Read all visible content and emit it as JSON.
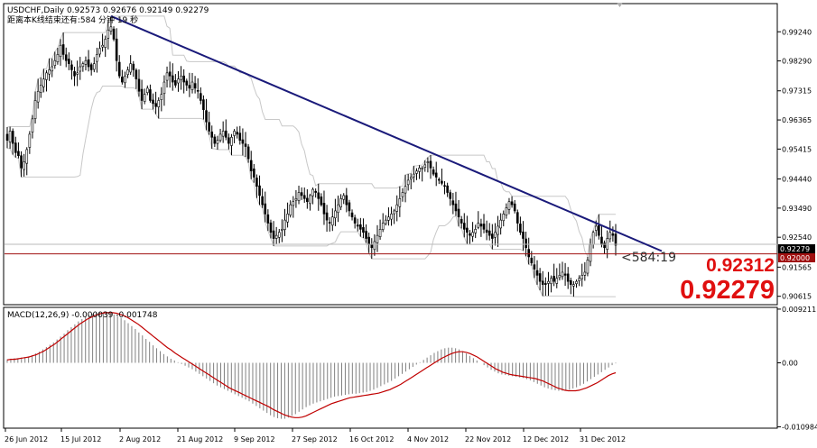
{
  "header": {
    "symbol_line": "USDCHF,Daily  0.92573 0.92676 0.92149 0.92279",
    "countdown_line": "距离本K线结束还有:584 分钟 19 秒"
  },
  "macd_header": "MACD(12,26,9) -0.000039 -0.001748",
  "countdown_label": "<584:19",
  "big_prices": [
    "0.92312",
    "0.92279"
  ],
  "price_tags": {
    "current": "0.92279",
    "line": "0.92000"
  },
  "colors": {
    "trend_line": "#1a1a7a",
    "support_line": "#a01010",
    "signal_line": "#c00000",
    "big_price": "#e01010",
    "band": "#c8c8c8",
    "candle": "#000000"
  },
  "chart_data": [
    {
      "type": "candlestick",
      "title": "USDCHF,Daily",
      "ylim": [
        0.904,
        1.001
      ],
      "y_ticks": [
        "0.99240",
        "0.98290",
        "0.97315",
        "0.96365",
        "0.95415",
        "0.94440",
        "0.93490",
        "0.92540",
        "0.91565",
        "0.90615"
      ],
      "x_ticks": [
        "26 Jun 2012",
        "15 Jul 2012",
        "2 Aug 2012",
        "21 Aug 2012",
        "9 Sep 2012",
        "27 Sep 2012",
        "16 Oct 2012",
        "4 Nov 2012",
        "22 Nov 2012",
        "12 Dec 2012",
        "31 Dec 2012"
      ],
      "closes": [
        0.957,
        0.96,
        0.956,
        0.953,
        0.952,
        0.948,
        0.95,
        0.954,
        0.959,
        0.964,
        0.97,
        0.973,
        0.975,
        0.977,
        0.979,
        0.98,
        0.981,
        0.983,
        0.985,
        0.988,
        0.985,
        0.983,
        0.982,
        0.98,
        0.978,
        0.979,
        0.981,
        0.982,
        0.983,
        0.981,
        0.98,
        0.982,
        0.985,
        0.987,
        0.988,
        0.99,
        0.993,
        0.994,
        0.99,
        0.983,
        0.978,
        0.976,
        0.978,
        0.98,
        0.982,
        0.98,
        0.977,
        0.973,
        0.97,
        0.972,
        0.974,
        0.97,
        0.969,
        0.968,
        0.97,
        0.972,
        0.976,
        0.979,
        0.978,
        0.976,
        0.975,
        0.977,
        0.978,
        0.976,
        0.975,
        0.974,
        0.976,
        0.974,
        0.973,
        0.97,
        0.967,
        0.963,
        0.96,
        0.958,
        0.956,
        0.957,
        0.959,
        0.96,
        0.958,
        0.956,
        0.958,
        0.96,
        0.959,
        0.957,
        0.956,
        0.955,
        0.951,
        0.947,
        0.945,
        0.942,
        0.939,
        0.936,
        0.933,
        0.93,
        0.927,
        0.925,
        0.926,
        0.927,
        0.928,
        0.931,
        0.933,
        0.936,
        0.937,
        0.938,
        0.94,
        0.939,
        0.938,
        0.937,
        0.939,
        0.941,
        0.94,
        0.938,
        0.936,
        0.933,
        0.931,
        0.93,
        0.932,
        0.934,
        0.936,
        0.938,
        0.939,
        0.936,
        0.934,
        0.932,
        0.93,
        0.929,
        0.928,
        0.927,
        0.925,
        0.923,
        0.922,
        0.924,
        0.926,
        0.928,
        0.93,
        0.931,
        0.932,
        0.933,
        0.934,
        0.936,
        0.938,
        0.94,
        0.942,
        0.944,
        0.945,
        0.946,
        0.947,
        0.948,
        0.948,
        0.949,
        0.95,
        0.948,
        0.946,
        0.945,
        0.944,
        0.943,
        0.942,
        0.94,
        0.938,
        0.936,
        0.934,
        0.932,
        0.93,
        0.928,
        0.927,
        0.926,
        0.927,
        0.928,
        0.93,
        0.929,
        0.928,
        0.927,
        0.926,
        0.925,
        0.927,
        0.929,
        0.931,
        0.933,
        0.935,
        0.937,
        0.936,
        0.934,
        0.93,
        0.927,
        0.925,
        0.922,
        0.919,
        0.917,
        0.915,
        0.913,
        0.911,
        0.91,
        0.91,
        0.911,
        0.912,
        0.911,
        0.912,
        0.913,
        0.914,
        0.913,
        0.911,
        0.91,
        0.91,
        0.911,
        0.912,
        0.913,
        0.914,
        0.918,
        0.923,
        0.927,
        0.929,
        0.926,
        0.923,
        0.922,
        0.925,
        0.927,
        0.926,
        0.9228
      ]
    },
    {
      "type": "bar",
      "title": "MACD(12,26,9)",
      "ylim": [
        -0.0109,
        0.0092
      ],
      "y_ticks": [
        "0.009211",
        "0.00",
        "-0.010984"
      ],
      "histogram": [
        0.0006,
        0.0007,
        0.0008,
        0.0008,
        0.0009,
        0.001,
        0.0011,
        0.0013,
        0.0016,
        0.0019,
        0.0023,
        0.0027,
        0.0031,
        0.0035,
        0.004,
        0.0045,
        0.005,
        0.0056,
        0.0061,
        0.0066,
        0.0071,
        0.0075,
        0.0079,
        0.0082,
        0.0084,
        0.0086,
        0.0087,
        0.0087,
        0.0086,
        0.0085,
        0.0083,
        0.008,
        0.0077,
        0.0073,
        0.0068,
        0.0063,
        0.0058,
        0.0052,
        0.0047,
        0.0041,
        0.0036,
        0.003,
        0.0025,
        0.002,
        0.0015,
        0.0011,
        0.0007,
        0.0004,
        0.0001,
        -0.0002,
        -0.0005,
        -0.0008,
        -0.0011,
        -0.0015,
        -0.0019,
        -0.0023,
        -0.0027,
        -0.0031,
        -0.0035,
        -0.0039,
        -0.0042,
        -0.0045,
        -0.0048,
        -0.0051,
        -0.0054,
        -0.0057,
        -0.006,
        -0.0063,
        -0.0066,
        -0.007,
        -0.0074,
        -0.0078,
        -0.0082,
        -0.0086,
        -0.009,
        -0.0093,
        -0.0095,
        -0.0096,
        -0.0096,
        -0.0094,
        -0.0091,
        -0.0088,
        -0.0084,
        -0.008,
        -0.0076,
        -0.0073,
        -0.007,
        -0.0068,
        -0.0066,
        -0.0064,
        -0.0062,
        -0.006,
        -0.0058,
        -0.0057,
        -0.0056,
        -0.0055,
        -0.0054,
        -0.0053,
        -0.0053,
        -0.0052,
        -0.0051,
        -0.005,
        -0.0048,
        -0.0046,
        -0.0043,
        -0.004,
        -0.0037,
        -0.0034,
        -0.0031,
        -0.0027,
        -0.0023,
        -0.0019,
        -0.0015,
        -0.0011,
        -0.0007,
        -0.0003,
        0.0001,
        0.0005,
        0.0009,
        0.0013,
        0.0017,
        0.002,
        0.0023,
        0.0025,
        0.0026,
        0.0026,
        0.0025,
        0.0023,
        0.002,
        0.0016,
        0.0012,
        0.0008,
        0.0004,
        0.0,
        -0.0004,
        -0.0008,
        -0.0012,
        -0.0015,
        -0.0018,
        -0.002,
        -0.0021,
        -0.0022,
        -0.0023,
        -0.0024,
        -0.0025,
        -0.0026,
        -0.0028,
        -0.003,
        -0.0033,
        -0.0036,
        -0.0039,
        -0.0042,
        -0.0044,
        -0.0046,
        -0.0047,
        -0.0048,
        -0.0048,
        -0.0047,
        -0.0046,
        -0.0044,
        -0.0042,
        -0.0039,
        -0.0036,
        -0.0032,
        -0.0028,
        -0.0024,
        -0.002,
        -0.0016,
        -0.0012,
        -0.0008,
        -0.0004,
        -0.0001
      ],
      "signal": [
        0.0005,
        0.0006,
        0.0006,
        0.0007,
        0.0008,
        0.0009,
        0.001,
        0.0012,
        0.0014,
        0.0017,
        0.002,
        0.0024,
        0.0028,
        0.0032,
        0.0037,
        0.0042,
        0.0047,
        0.0052,
        0.0057,
        0.0062,
        0.0067,
        0.0071,
        0.0075,
        0.0078,
        0.0081,
        0.0083,
        0.0085,
        0.0086,
        0.0086,
        0.0086,
        0.0085,
        0.0083,
        0.0081,
        0.0078,
        0.0074,
        0.007,
        0.0066,
        0.0061,
        0.0056,
        0.0051,
        0.0046,
        0.0041,
        0.0036,
        0.0031,
        0.0026,
        0.0022,
        0.0017,
        0.0013,
        0.0009,
        0.0005,
        0.0001,
        -0.0003,
        -0.0007,
        -0.0011,
        -0.0015,
        -0.0019,
        -0.0023,
        -0.0027,
        -0.0031,
        -0.0035,
        -0.0039,
        -0.0043,
        -0.0046,
        -0.0049,
        -0.0052,
        -0.0055,
        -0.0058,
        -0.0061,
        -0.0064,
        -0.0067,
        -0.007,
        -0.0073,
        -0.0076,
        -0.008,
        -0.0083,
        -0.0086,
        -0.0089,
        -0.0091,
        -0.0093,
        -0.0094,
        -0.0094,
        -0.0093,
        -0.0091,
        -0.0088,
        -0.0085,
        -0.0082,
        -0.0079,
        -0.0076,
        -0.0073,
        -0.007,
        -0.0068,
        -0.0066,
        -0.0064,
        -0.0062,
        -0.006,
        -0.0059,
        -0.0058,
        -0.0057,
        -0.0056,
        -0.0055,
        -0.0054,
        -0.0053,
        -0.0052,
        -0.005,
        -0.0048,
        -0.0046,
        -0.0043,
        -0.004,
        -0.0037,
        -0.0033,
        -0.0029,
        -0.0025,
        -0.0021,
        -0.0017,
        -0.0013,
        -0.0009,
        -0.0005,
        -0.0001,
        0.0003,
        0.0007,
        0.001,
        0.0013,
        0.0016,
        0.0018,
        0.0019,
        0.0019,
        0.0018,
        0.0016,
        0.0013,
        0.001,
        0.0006,
        0.0002,
        -0.0002,
        -0.0006,
        -0.001,
        -0.0013,
        -0.0016,
        -0.0018,
        -0.002,
        -0.0021,
        -0.0022,
        -0.0023,
        -0.0024,
        -0.0025,
        -0.0026,
        -0.0027,
        -0.0029,
        -0.0031,
        -0.0034,
        -0.0037,
        -0.004,
        -0.0043,
        -0.0045,
        -0.0047,
        -0.0048,
        -0.0048,
        -0.0048,
        -0.0047,
        -0.0045,
        -0.0043,
        -0.004,
        -0.0037,
        -0.0034,
        -0.003,
        -0.0026,
        -0.0022,
        -0.0019,
        -0.0017
      ]
    }
  ]
}
